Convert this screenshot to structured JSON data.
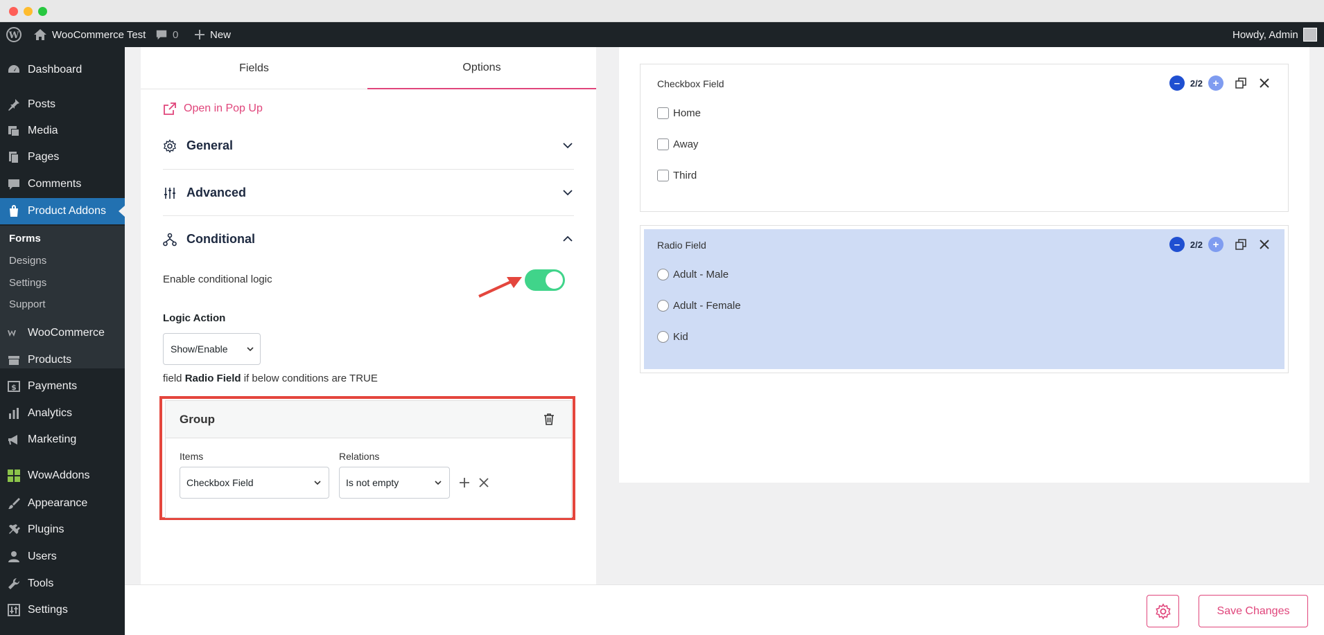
{
  "adminbar": {
    "site_name": "WooCommerce Test",
    "comments_count": "0",
    "new_label": "New",
    "howdy": "Howdy, Admin"
  },
  "sidebar": {
    "items": [
      {
        "label": "Dashboard",
        "icon": "dashboard-icon"
      },
      {
        "label": "Posts",
        "icon": "pin-icon"
      },
      {
        "label": "Media",
        "icon": "media-icon"
      },
      {
        "label": "Pages",
        "icon": "pages-icon"
      },
      {
        "label": "Comments",
        "icon": "comment-icon"
      },
      {
        "label": "Product Addons",
        "icon": "product-addons-icon"
      },
      {
        "label": "WooCommerce",
        "icon": "woocommerce-icon"
      },
      {
        "label": "Products",
        "icon": "archive-icon"
      },
      {
        "label": "Payments",
        "icon": "dollar-icon"
      },
      {
        "label": "Analytics",
        "icon": "bar-chart-icon"
      },
      {
        "label": "Marketing",
        "icon": "megaphone-icon"
      },
      {
        "label": "WowAddons",
        "icon": "grid-icon"
      },
      {
        "label": "Appearance",
        "icon": "brush-icon"
      },
      {
        "label": "Plugins",
        "icon": "plug-icon"
      },
      {
        "label": "Users",
        "icon": "user-icon"
      },
      {
        "label": "Tools",
        "icon": "wrench-icon"
      },
      {
        "label": "Settings",
        "icon": "settings-icon"
      }
    ],
    "submenu": [
      "Forms",
      "Designs",
      "Settings",
      "Support"
    ]
  },
  "editor": {
    "tabs": [
      "Fields",
      "Options"
    ],
    "active_tab": "Options",
    "popup_link": "Open in Pop Up",
    "sections": [
      "General",
      "Advanced",
      "Conditional"
    ],
    "enable_label": "Enable conditional logic",
    "enable_state": true,
    "logic_action_label": "Logic Action",
    "logic_action_value": "Show/Enable",
    "field_line_prefix": "field",
    "field_line_name": "Radio Field",
    "field_line_suffix": "if below conditions are TRUE",
    "group": {
      "title": "Group",
      "items_label": "Items",
      "relations_label": "Relations",
      "item_value": "Checkbox Field",
      "relation_value": "Is not empty"
    }
  },
  "preview": {
    "cards": [
      {
        "title": "Checkbox Field",
        "count": "2/2",
        "options": [
          "Home",
          "Away",
          "Third"
        ]
      },
      {
        "title": "Radio Field",
        "count": "2/2",
        "options": [
          "Adult - Male",
          "Adult - Female",
          "Kid"
        ]
      }
    ]
  },
  "footer": {
    "save_label": "Save Changes"
  },
  "colors": {
    "accent": "#e0457b",
    "toggle_on": "#40d48a",
    "highlight_box": "#e4463d",
    "selected_card": "#cfdcf5",
    "admin_bg": "#1d2327",
    "active_menu": "#2271b1"
  }
}
